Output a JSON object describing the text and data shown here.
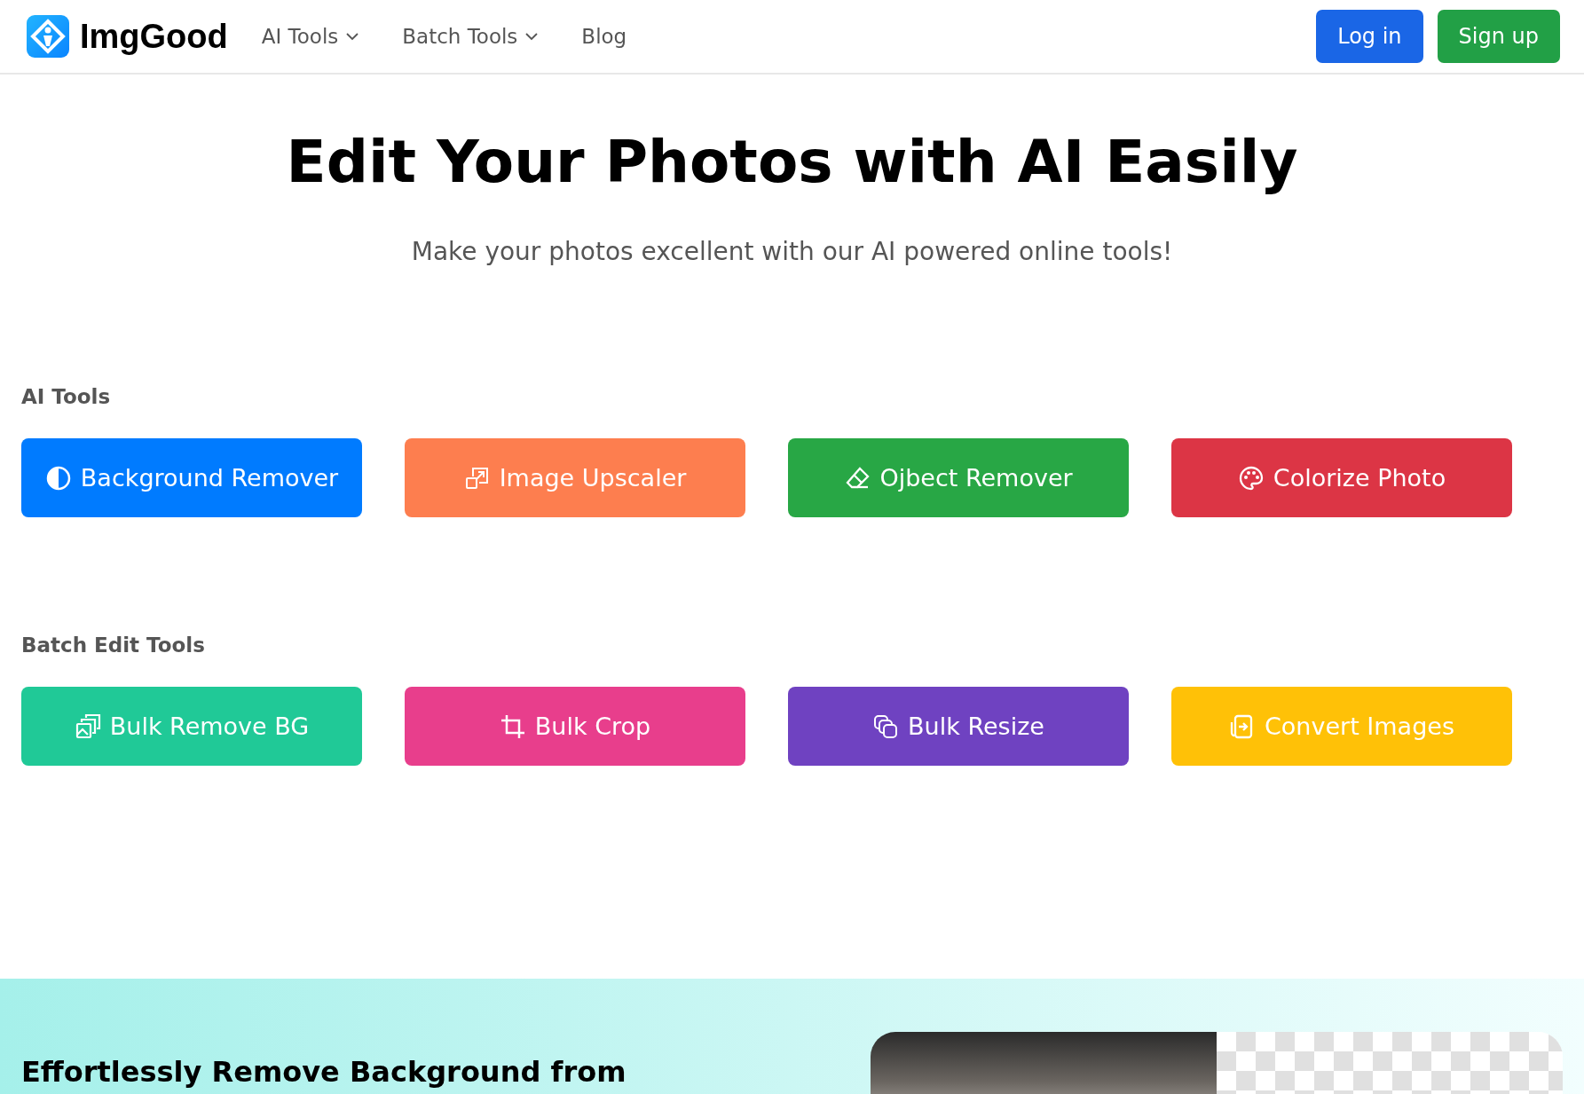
{
  "header": {
    "brand": "ImgGood",
    "nav": [
      {
        "label": "AI Tools",
        "dropdown": true
      },
      {
        "label": "Batch Tools",
        "dropdown": true
      },
      {
        "label": "Blog",
        "dropdown": false
      }
    ],
    "login": "Log in",
    "signup": "Sign up"
  },
  "hero": {
    "title": "Edit Your Photos with AI Easily",
    "subtitle": "Make your photos excellent with our AI powered online tools!"
  },
  "sections": [
    {
      "heading": "AI Tools",
      "tools": [
        {
          "label": "Background Remover",
          "color": "#007bff",
          "kind": "contrast"
        },
        {
          "label": "Image Upscaler",
          "color": "#fd7e4f",
          "kind": "upscale"
        },
        {
          "label": "Ojbect Remover",
          "color": "#28a745",
          "kind": "eraser"
        },
        {
          "label": "Colorize Photo",
          "color": "#dc3545",
          "kind": "palette"
        }
      ]
    },
    {
      "heading": "Batch Edit Tools",
      "tools": [
        {
          "label": "Bulk Remove BG",
          "color": "#20c997",
          "kind": "images"
        },
        {
          "label": "Bulk Crop",
          "color": "#e83e8c",
          "kind": "crop"
        },
        {
          "label": "Bulk Resize",
          "color": "#6f42c1",
          "kind": "copies"
        },
        {
          "label": "Convert Images",
          "color": "#ffc107",
          "kind": "convert"
        }
      ]
    }
  ],
  "feature": {
    "heading": "Effortlessly Remove Background from"
  }
}
